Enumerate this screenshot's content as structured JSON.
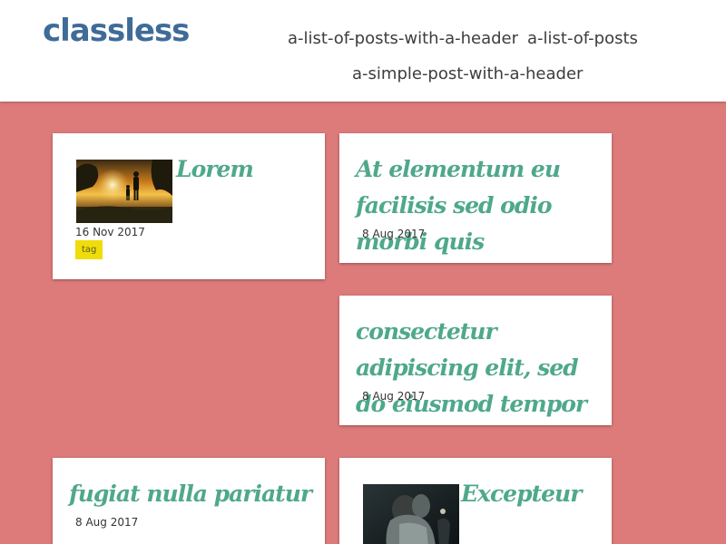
{
  "site": {
    "title": "classless"
  },
  "nav": {
    "items": [
      {
        "label": "a-list-of-posts-with-a-header"
      },
      {
        "label": "a-list-of-posts"
      },
      {
        "label": "a-simple-post-with-a-header"
      }
    ]
  },
  "colors": {
    "background": "#dd7b7b",
    "site_title": "#3f6b99",
    "post_title": "#4fa88c",
    "tag_background": "#f0dc0a"
  },
  "posts": [
    {
      "title": "Lorem",
      "date": "16 Nov 2017",
      "tag": "tag",
      "thumbnail": "sunset-silhouette-photo"
    },
    {
      "title": "At elementum eu facilisis sed odio morbi quis",
      "date": "8 Aug 2017"
    },
    {
      "title": "consectetur adipiscing elit, sed do eiusmod tempor",
      "date": "8 Aug 2017"
    },
    {
      "title": "fugiat nulla pariatur",
      "date": "8 Aug 2017"
    },
    {
      "title": "Excepteur",
      "thumbnail": "dark-embrace-photo"
    }
  ]
}
